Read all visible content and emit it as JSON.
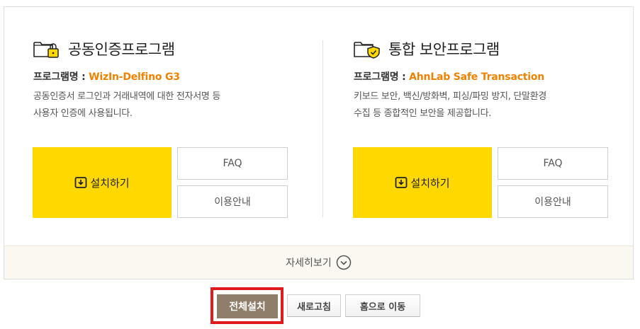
{
  "sections": [
    {
      "title": "공동인증프로그램",
      "icon": "folder-lock-icon",
      "program_label": "프로그램명 : ",
      "program_name": "WizIn-Delfino G3",
      "desc_line1": "공동인증서 로그인과 거래내역에 대한 전자서명 등",
      "desc_line2": "사용자 인증에 사용됩니다.",
      "install_label": "설치하기",
      "faq_label": "FAQ",
      "guide_label": "이용안내"
    },
    {
      "title": "통합 보안프로그램",
      "icon": "folder-shield-icon",
      "program_label": "프로그램명 : ",
      "program_name": "AhnLab Safe Transaction",
      "desc_line1": "키보드 보안, 백신/방화벽, 피싱/파밍 방지, 단말환경",
      "desc_line2": "수집 등 종합적인 보안을 제공합니다.",
      "install_label": "설치하기",
      "faq_label": "FAQ",
      "guide_label": "이용안내"
    }
  ],
  "more_label": "자세히보기",
  "buttons": {
    "install_all": "전체설치",
    "refresh": "새로고침",
    "go_home": "홈으로 이동"
  },
  "colors": {
    "install_yellow": "#ffd800",
    "program_name_orange": "#ef8200",
    "install_all_bg": "#8f7e6a",
    "highlight_red": "#e01b1b"
  }
}
